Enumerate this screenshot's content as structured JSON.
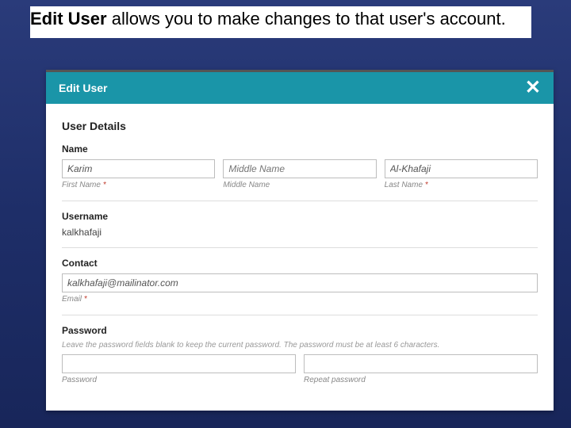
{
  "caption": {
    "bold": "Edit User",
    "rest": " allows you to make changes to that user's account."
  },
  "modal": {
    "title": "Edit User",
    "close_glyph": "✕"
  },
  "user_details": {
    "section_title": "User Details",
    "name": {
      "group_label": "Name",
      "first": {
        "value": "Karim",
        "label": "First Name",
        "required": "*"
      },
      "middle": {
        "value": "",
        "placeholder": "Middle Name",
        "label": "Middle Name",
        "required": ""
      },
      "last": {
        "value": "Al-Khafaji",
        "label": "Last Name",
        "required": "*"
      }
    },
    "username": {
      "group_label": "Username",
      "value": "kalkhafaji"
    },
    "contact": {
      "group_label": "Contact",
      "email": {
        "value": "kalkhafaji@mailinator.com",
        "label": "Email",
        "required": "*"
      }
    },
    "password": {
      "group_label": "Password",
      "help": "Leave the password fields blank to keep the current password. The password must be at least 6 characters.",
      "pw": {
        "value": "",
        "label": "Password"
      },
      "pw2": {
        "value": "",
        "label": "Repeat password"
      }
    }
  }
}
